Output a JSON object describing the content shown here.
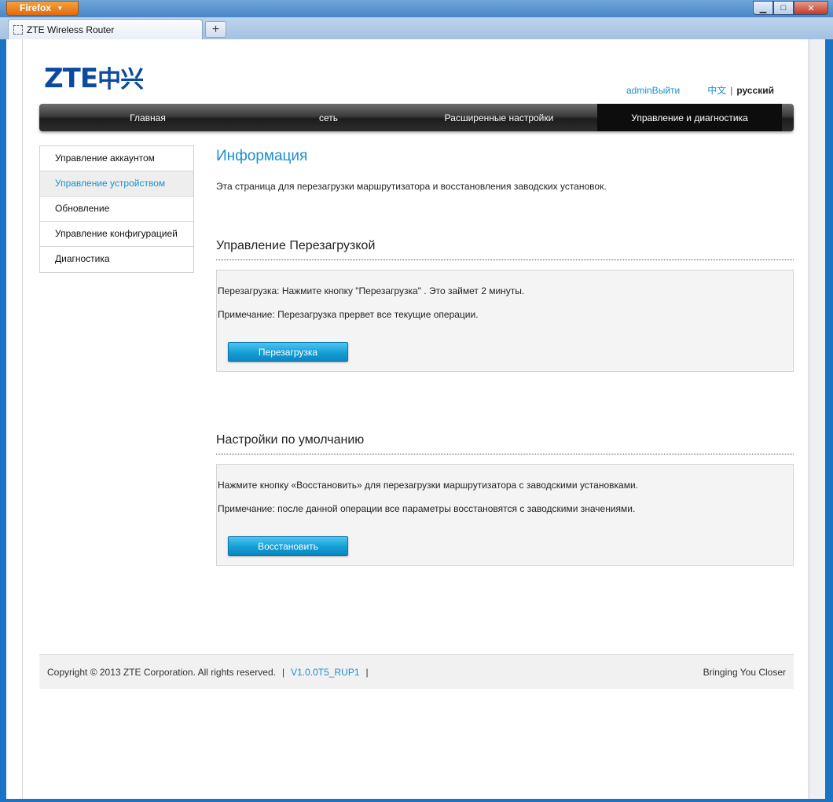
{
  "browser": {
    "app_button": "Firefox",
    "tab_title": "ZTE Wireless Router",
    "new_tab": "+",
    "controls": {
      "minimize": "▁",
      "maximize": "□",
      "close": "✕"
    }
  },
  "header": {
    "logo_text": "ZTE",
    "logo_cn": "中兴",
    "user_link": "adminВыйти",
    "lang_cn": "中文",
    "lang_sep": "|",
    "lang_ru": "русский"
  },
  "nav": {
    "items": [
      {
        "label": "Главная"
      },
      {
        "label": "сеть"
      },
      {
        "label": "Расширенные настройки"
      },
      {
        "label": "Управление и диагностика"
      }
    ],
    "active_index": 3
  },
  "sidebar": {
    "items": [
      {
        "label": "Управление аккаунтом"
      },
      {
        "label": "Управление устройством"
      },
      {
        "label": "Обновление"
      },
      {
        "label": "Управление конфигурацией"
      },
      {
        "label": "Диагностика"
      }
    ],
    "active_index": 1
  },
  "main": {
    "title": "Информация",
    "description": "Эта страница для перезагрузки маршрутизатора и восстановления заводских установок.",
    "reboot": {
      "title": "Управление Перезагрузкой",
      "text": "Перезагрузка: Нажмите кнопку \"Перезагрузка\" . Это займет 2 минуты.",
      "note": "Примечание: Перезагрузка прервет все текущие операции.",
      "button": "Перезагрузка"
    },
    "restore": {
      "title": "Настройки по умолчанию",
      "text": "Нажмите кнопку «Восстановить» для перезагрузки маршрутизатора с заводскими установками.",
      "note": "Примечание: после данной операции все параметры восстановятся с заводскими значениями.",
      "button": "Восстановить"
    }
  },
  "footer": {
    "copyright": "Copyright © 2013 ZTE Corporation. All rights reserved.",
    "pipe": "|",
    "version": "V1.0.0T5_RUP1",
    "tagline": "Bringing You Closer"
  },
  "colors": {
    "accent": "#1b8fce",
    "nav_bg": "#2d2d2d",
    "logo": "#0b4a9e",
    "button": "#159ed6"
  }
}
